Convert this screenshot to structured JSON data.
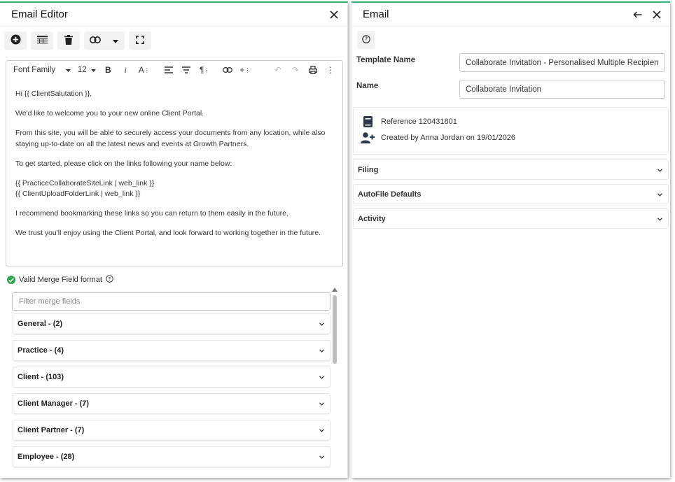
{
  "left_panel": {
    "title": "Email Editor",
    "editor_toolbar": {
      "font_family": "Font Family",
      "font_size": "12"
    },
    "content": {
      "paragraphs": [
        "Hi {{ ClientSalutation }},",
        "We'd like to welcome you to your new online Client Portal.",
        "From this site, you will be able to securely access your documents from any location, while also staying up-to-date on all the latest news and events at Growth Partners.",
        "To get started, please click on the links following your name below:"
      ],
      "links": [
        "{{ PracticeCollaborateSiteLink | web_link }}",
        "{{ ClientUploadFolderLink | web_link }}"
      ],
      "closing": [
        "I recommend bookmarking these links so you can return to them easily in the future.",
        "We trust you'll enjoy using the Client Portal, and look forward to working together in the future."
      ]
    },
    "merge": {
      "valid_text": "Valid Merge Field format",
      "filter_placeholder": "Filter merge fields",
      "categories": [
        "General - (2)",
        "Practice - (4)",
        "Client - (103)",
        "Client Manager - (7)",
        "Client Partner - (7)",
        "Employee - (28)"
      ]
    }
  },
  "right_panel": {
    "title": "Email",
    "template_name_label": "Template Name",
    "template_name_value": "Collaborate Invitation - Personalised Multiple Recipients",
    "name_label": "Name",
    "name_value": "Collaborate Invitation",
    "reference": "Reference 120431801",
    "created_by": "Created by Anna Jordan on 19/01/2026",
    "sections": [
      "Filing",
      "AutoFile Defaults",
      "Activity"
    ]
  },
  "colors": {
    "accent_green": "#3bb27a",
    "valid_green": "#2ea44f",
    "icon_dark": "#2b3a4a"
  }
}
